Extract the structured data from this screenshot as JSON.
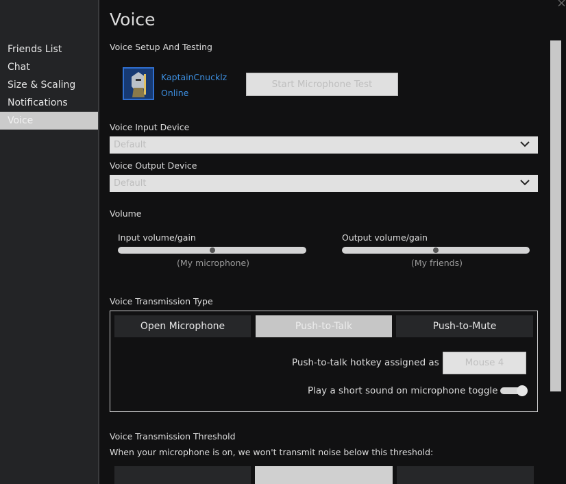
{
  "sidebar": {
    "items": [
      {
        "label": "Friends List"
      },
      {
        "label": "Chat"
      },
      {
        "label": "Size & Scaling"
      },
      {
        "label": "Notifications"
      },
      {
        "label": "Voice",
        "active": true
      }
    ]
  },
  "page": {
    "title": "Voice",
    "close_icon": "×"
  },
  "setup": {
    "heading": "Voice Setup And Testing",
    "username": "KaptainCnucklz",
    "status": "Online",
    "test_button": "Start Microphone Test"
  },
  "devices": {
    "input_label": "Voice Input Device",
    "input_value": "Default",
    "output_label": "Voice Output Device",
    "output_value": "Default"
  },
  "volume": {
    "heading": "Volume",
    "input_label": "Input volume/gain",
    "input_sub": "(My microphone)",
    "input_level": 0.5,
    "output_label": "Output volume/gain",
    "output_sub": "(My friends)",
    "output_level": 0.5
  },
  "transmission": {
    "heading": "Voice Transmission Type",
    "options": [
      "Open Microphone",
      "Push-to-Talk",
      "Push-to-Mute"
    ],
    "selected": "Push-to-Talk",
    "hotkey_label": "Push-to-talk hotkey assigned as",
    "hotkey_value": "Mouse 4",
    "toggle_label": "Play a short sound on microphone toggle",
    "toggle_on": true
  },
  "threshold": {
    "heading": "Voice Transmission Threshold",
    "description": "When your microphone is on, we won't transmit noise below this threshold:"
  }
}
